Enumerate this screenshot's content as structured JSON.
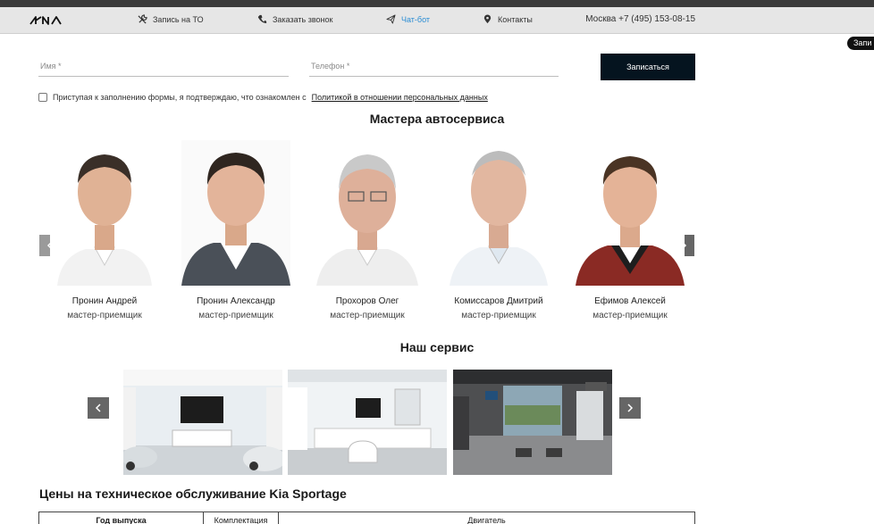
{
  "header": {
    "logo_text": "KIA",
    "nav": [
      {
        "label": "Запись на ТО",
        "icon": "wrench-icon"
      },
      {
        "label": "Заказать звонок",
        "icon": "phone-icon"
      },
      {
        "label": "Чат-бот",
        "icon": "send-icon",
        "active": true
      },
      {
        "label": "Контакты",
        "icon": "location-pin-icon"
      }
    ],
    "phone": "Москва +7 (495) 153-08-15",
    "accent_color": "#2a8dd4"
  },
  "side_pill": "Запи",
  "form": {
    "name_placeholder": "Имя *",
    "phone_placeholder": "Телефон *",
    "submit_label": "Записаться",
    "consent_text": "Приступая к заполнению формы, я подтверждаю, что ознакомлен с",
    "consent_link": "Политикой в отношении персональных данных"
  },
  "masters": {
    "title": "Мастера автосервиса",
    "items": [
      {
        "name": "Пронин Андрей",
        "role": "мастер-приемщик"
      },
      {
        "name": "Пронин Александр",
        "role": "мастер-приемщик"
      },
      {
        "name": "Прохоров Олег",
        "role": "мастер-приемщик"
      },
      {
        "name": "Комиссаров Дмитрий",
        "role": "мастер-приемщик"
      },
      {
        "name": "Ефимов Алексей",
        "role": "мастер-приемщик"
      }
    ]
  },
  "service": {
    "title": "Наш сервис"
  },
  "prices": {
    "title": "Цены на техническое обслуживание Kia Sportage",
    "columns": [
      "Год выпуска",
      "Комплектация",
      "Двигатель"
    ]
  }
}
